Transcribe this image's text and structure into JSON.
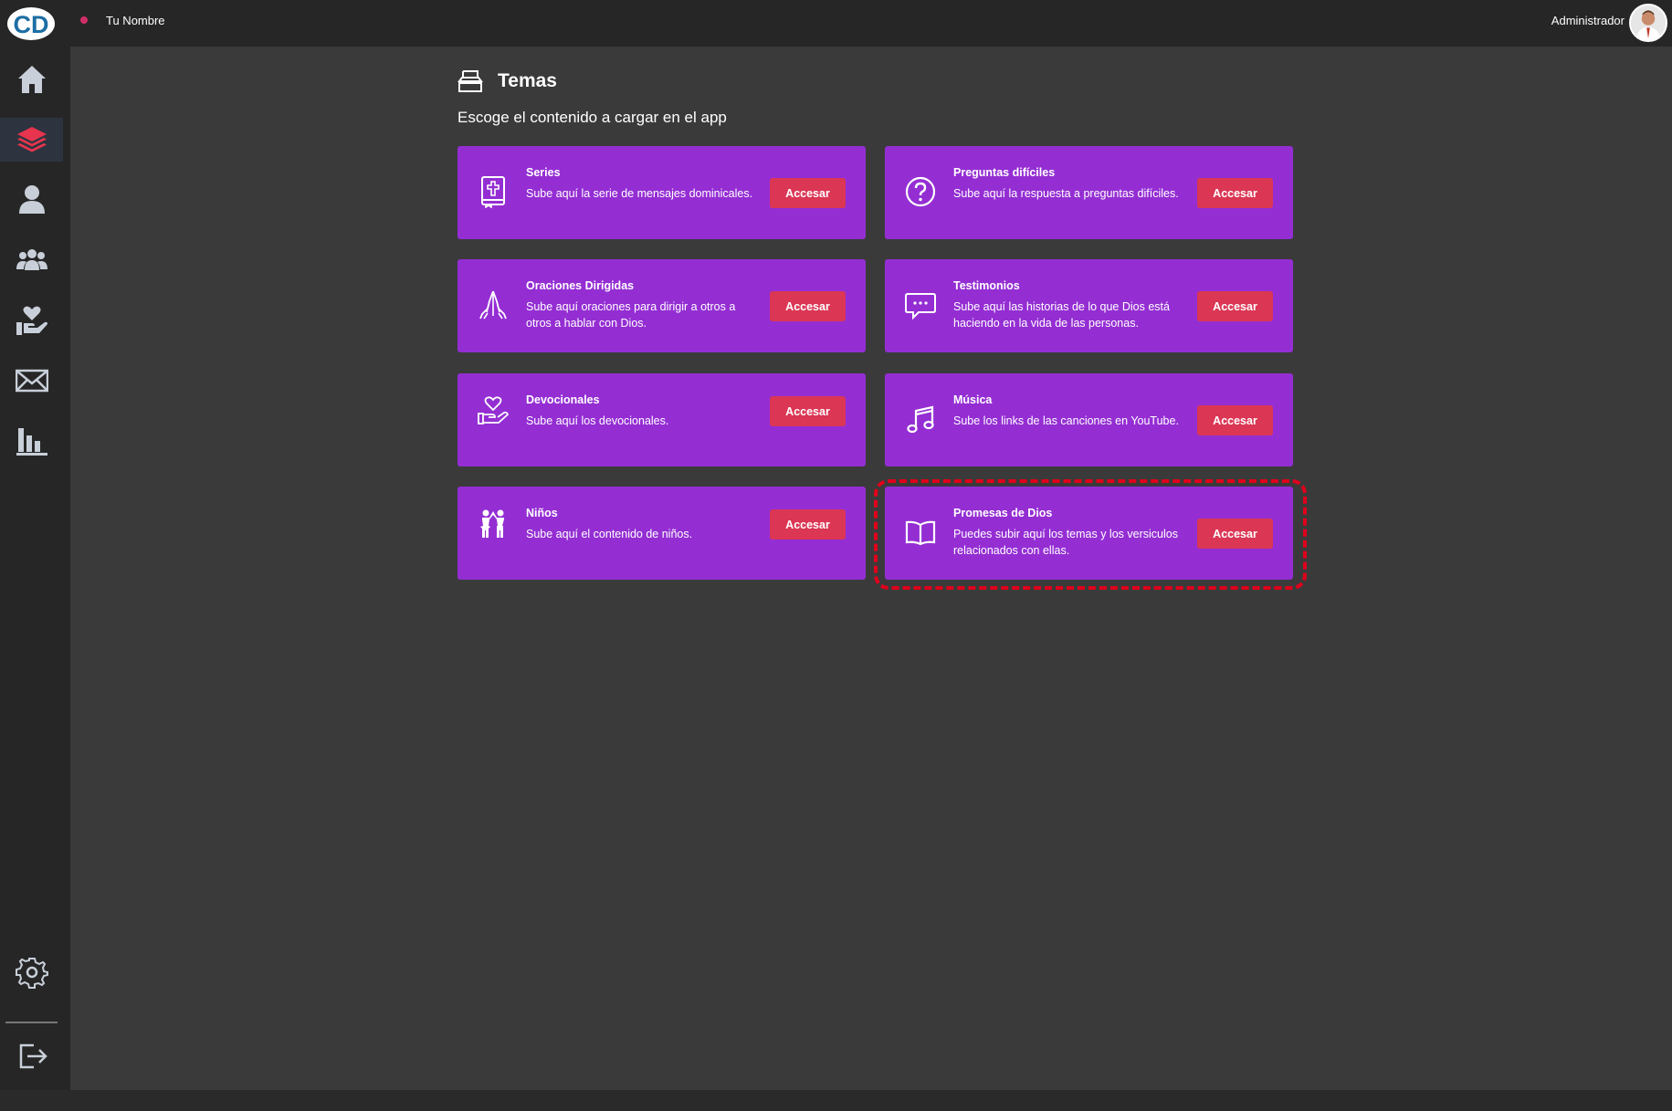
{
  "header": {
    "logo_text": "CD",
    "user_name": "Tu Nombre",
    "role_label": "Administrador"
  },
  "sidebar": {
    "items": [
      {
        "icon": "home-icon"
      },
      {
        "icon": "layers-icon",
        "active": true
      },
      {
        "icon": "user-icon"
      },
      {
        "icon": "users-group-icon"
      },
      {
        "icon": "heart-hand-icon"
      },
      {
        "icon": "mail-icon"
      },
      {
        "icon": "bar-chart-icon"
      }
    ],
    "bottom_items": [
      {
        "icon": "gear-icon"
      },
      {
        "icon": "logout-icon"
      }
    ]
  },
  "main": {
    "title": "Temas",
    "subtitle": "Escoge el contenido a cargar en el app",
    "cards": [
      {
        "icon": "bible-icon",
        "title": "Series",
        "description": "Sube aquí la serie de mensajes dominicales.",
        "button": "Accesar"
      },
      {
        "icon": "question-circle-icon",
        "title": "Preguntas difíciles",
        "description": "Sube aquí la respuesta a preguntas difíciles.",
        "button": "Accesar"
      },
      {
        "icon": "praying-hands-icon",
        "title": "Oraciones Dirigidas",
        "description": "Sube aquí oraciones para dirigir a otros a otros a hablar con Dios.",
        "button": "Accesar"
      },
      {
        "icon": "chat-bubble-icon",
        "title": "Testimonios",
        "description": "Sube aquí las historias de lo que Dios está haciendo en la vida de las personas.",
        "button": "Accesar"
      },
      {
        "icon": "heart-hand-icon",
        "title": "Devocionales",
        "description": "Sube aquí los devocionales.",
        "button": "Accesar"
      },
      {
        "icon": "music-note-icon",
        "title": "Música",
        "description": "Sube los links de las canciones en YouTube.",
        "button": "Accesar"
      },
      {
        "icon": "children-icon",
        "title": "Niños",
        "description": "Sube aquí el contenido de niños.",
        "button": "Accesar"
      },
      {
        "icon": "open-book-icon",
        "title": "Promesas de Dios",
        "description": "Puedes subir aquí los temas y los versiculos relacionados con ellas.",
        "button": "Accesar",
        "highlighted": true
      }
    ]
  },
  "colors": {
    "topbar": "#262626",
    "background": "#3a3a3a",
    "card": "#942ed3",
    "button": "#db3654",
    "highlight": "#e0001b",
    "active_icon": "#e8344e"
  }
}
